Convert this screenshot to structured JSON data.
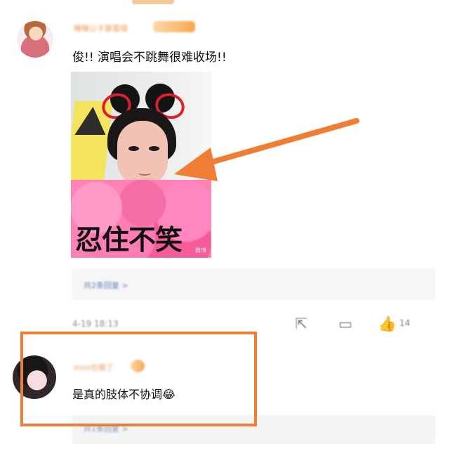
{
  "first_comment": {
    "author_name": "睡睡公子暴富喵",
    "badge": "",
    "text": "俊!! 演唱会不跳舞很难收场!!",
    "meme_caption": "忍住不笑",
    "watermark": "微博",
    "reply_preview": "共2条回复 >",
    "time": "4-19 18:13",
    "actions": {
      "forward_icon": "forward-icon",
      "comment_icon": "comment-icon",
      "like_icon": "like-icon",
      "like_count": "14"
    }
  },
  "second_comment": {
    "author_name": "mini也萌了",
    "text": "是真的肢体不协调😂",
    "reply_preview": "共1条回复 >",
    "emoji": "laughing-tears-icon"
  },
  "annotation": {
    "arrow_color": "#f07d34",
    "box_color": "#f07d34"
  }
}
